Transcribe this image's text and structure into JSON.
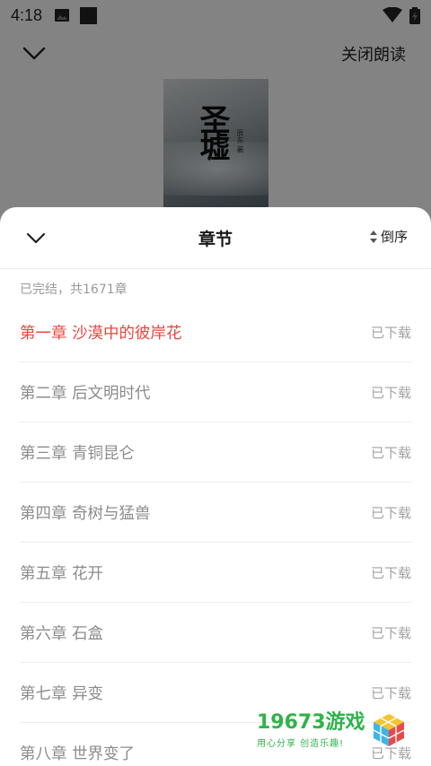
{
  "status_bar": {
    "time": "4:18"
  },
  "top_bar": {
    "close_read": "关闭朗读"
  },
  "cover": {
    "title": "圣墟",
    "subtitle": "辰东 著"
  },
  "sheet": {
    "title": "章节",
    "sort_label": "倒序",
    "summary": "已完结，共1671章",
    "chapters": [
      {
        "title": "第一章 沙漠中的彼岸花",
        "status": "已下载",
        "active": true
      },
      {
        "title": "第二章 后文明时代",
        "status": "已下载"
      },
      {
        "title": "第三章 青铜昆仑",
        "status": "已下载"
      },
      {
        "title": "第四章 奇树与猛兽",
        "status": "已下载"
      },
      {
        "title": "第五章 花开",
        "status": "已下载"
      },
      {
        "title": "第六章 石盒",
        "status": "已下载"
      },
      {
        "title": "第七章 异变",
        "status": "已下载"
      },
      {
        "title": "第八章 世界变了",
        "status": "已下载"
      }
    ]
  },
  "watermark": {
    "brand": "19673游戏",
    "slogan": "用心分享 创造乐趣!"
  },
  "colors": {
    "accent": "#e8483f",
    "watermark_green": "#2fb34a"
  }
}
